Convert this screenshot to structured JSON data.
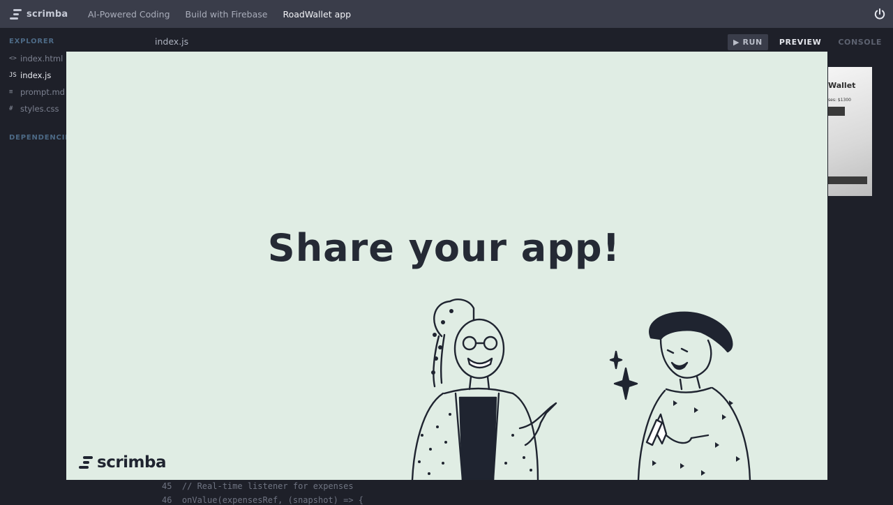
{
  "topbar": {
    "brand": "scrimba",
    "crumbs": [
      "AI-Powered Coding",
      "Build with Firebase",
      "RoadWallet app"
    ]
  },
  "sidebar": {
    "explorer_label": "EXPLORER",
    "files": [
      {
        "icon": "<>",
        "name": "index.html"
      },
      {
        "icon": "JS",
        "name": "index.js"
      },
      {
        "icon": "≡",
        "name": "prompt.md"
      },
      {
        "icon": "#",
        "name": "styles.css"
      }
    ],
    "dependencies_label": "DEPENDENCIES"
  },
  "editor": {
    "tab": "index.js",
    "code": [
      {
        "num": "45",
        "text": "// Real-time listener for expenses"
      },
      {
        "num": "46",
        "text": "onValue(expensesRef, (snapshot) => {"
      }
    ]
  },
  "toolbar": {
    "run": "RUN",
    "preview": "PREVIEW",
    "console": "CONSOLE"
  },
  "preview": {
    "title": "Wallet",
    "line": "ses: $1300"
  },
  "modal": {
    "title": "Share your app!",
    "logo": "scrimba"
  },
  "colors": {
    "modal_bg": "#e0ede4",
    "title": "#252a35",
    "topbar": "#3a3d4a",
    "app_bg": "#1e2029"
  }
}
